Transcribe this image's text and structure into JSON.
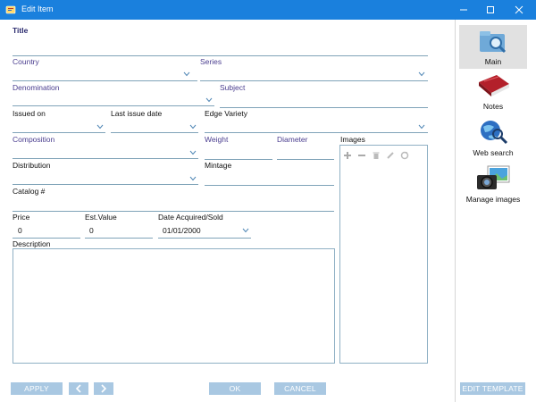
{
  "window": {
    "title": "Edit Item"
  },
  "form": {
    "title_label": "Title",
    "country_label": "Country",
    "series_label": "Series",
    "denomination_label": "Denomination",
    "subject_label": "Subject",
    "issued_on_label": "Issued on",
    "last_issue_date_label": "Last issue date",
    "edge_variety_label": "Edge Variety",
    "composition_label": "Composition",
    "weight_label": "Weight",
    "diameter_label": "Diameter",
    "images_label": "Images",
    "distribution_label": "Distribution",
    "mintage_label": "Mintage",
    "catalog_label": "Catalog #",
    "price_label": "Price",
    "price_value": "0",
    "est_value_label": "Est.Value",
    "est_value_value": "0",
    "date_acquired_label": "Date Acquired/Sold",
    "date_acquired_value": "01/01/2000",
    "description_label": "Description"
  },
  "sidebar": {
    "items": [
      {
        "label": "Main",
        "icon": "folder-search-icon"
      },
      {
        "label": "Notes",
        "icon": "notebook-icon"
      },
      {
        "label": "Web search",
        "icon": "globe-search-icon"
      },
      {
        "label": "Manage images",
        "icon": "camera-icon"
      }
    ]
  },
  "footer": {
    "apply_label": "APPLY",
    "ok_label": "OK",
    "cancel_label": "CANCEL",
    "edit_template_label": "EDIT TEMPLATE"
  },
  "colors": {
    "titlebar": "#1a80dd",
    "field_line": "#7fa3b8",
    "button": "#a9c8e2",
    "label_purple": "#4a3d8f"
  }
}
